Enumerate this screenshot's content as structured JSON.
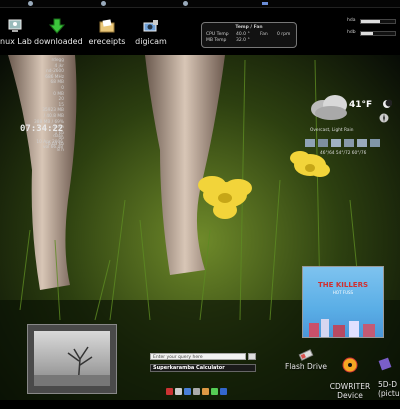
{
  "desktop_icons": [
    {
      "label": "nux Lab",
      "icon": "computer-icon"
    },
    {
      "label": "downloaded",
      "icon": "download-arrow-icon"
    },
    {
      "label": "ereceipts",
      "icon": "folder-icon"
    },
    {
      "label": "digicam",
      "icon": "camera-icon"
    }
  ],
  "temp_widget": {
    "title": "Temp / Fan",
    "cpu_label": "CPU Temp",
    "cpu_value": "40.0 °",
    "mb_label": "MB Temp",
    "mb_value": "32.0 °",
    "fan_label": "Fan",
    "fan_value": "0 rpm"
  },
  "meters": [
    {
      "label": "hda",
      "level": 0.55
    },
    {
      "label": "hdb",
      "level": 0.35
    }
  ],
  "sysinfo": {
    "lines": [
      "rdegg",
      "4 jkr",
      "nd-2600",
      "686 MHz",
      "68 MB",
      "0",
      "0 MB",
      "20",
      "15",
      "35923 MB",
      "/ 40.8 MB",
      "388 MB / 69%",
      "down",
      "1 kb",
      "up",
      "0.03 kb",
      "8 h"
    ],
    "clock": "07:34:22",
    "date_lines": [
      "date",
      "10 Apr 2006",
      "vol 66.48"
    ]
  },
  "weather": {
    "temp": "41°F",
    "line1": "Overcast, Light Rain",
    "line2": "46°/64  54°/72  60°/76"
  },
  "album": {
    "band": "THE KILLERS",
    "subtitle": "HOT FUSS"
  },
  "calculator": {
    "placeholder": "Enter your query here",
    "title": "Superkaramba Calculator"
  },
  "devices": [
    {
      "label": "Flash Drive",
      "icon": "flash-drive-icon"
    },
    {
      "label": "CDWRITER\nDevice",
      "icon": "cd-icon"
    },
    {
      "label": "5D-D\n(pictu",
      "icon": "disk-icon"
    }
  ],
  "colors": {
    "accent": "#6a8cd6",
    "flower": "#f2d43a",
    "grass": "#2f5a12"
  }
}
